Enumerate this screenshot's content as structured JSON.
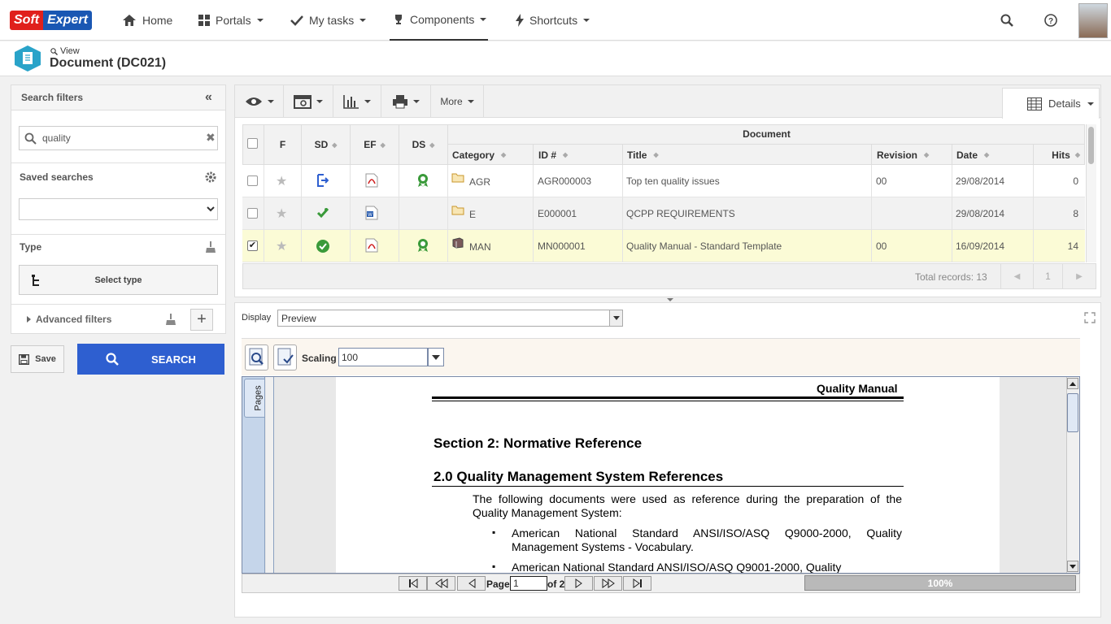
{
  "brand": {
    "part1": "Soft",
    "part2": "Expert"
  },
  "nav": {
    "home": "Home",
    "portals": "Portals",
    "mytasks": "My tasks",
    "components": "Components",
    "shortcuts": "Shortcuts"
  },
  "header": {
    "view": "View",
    "title": "Document (DC021)"
  },
  "filters": {
    "title": "Search filters",
    "search_value": "quality",
    "saved_searches": "Saved searches",
    "saved_value": "",
    "type": "Type",
    "select_type": "Select type",
    "advanced": "Advanced filters",
    "save": "Save",
    "search": "SEARCH"
  },
  "toolbar": {
    "more": "More",
    "details": "Details"
  },
  "grid": {
    "group_header": "Document",
    "columns": {
      "f": "F",
      "sd": "SD",
      "ef": "EF",
      "ds": "DS",
      "category": "Category",
      "id": "ID #",
      "title": "Title",
      "revision": "Revision",
      "date": "Date",
      "hits": "Hits"
    },
    "rows": [
      {
        "category": "AGR",
        "id": "AGR000003",
        "title": "Top ten quality issues",
        "revision": "00",
        "date": "29/08/2014",
        "hits": "0",
        "checked": false,
        "highlight": false
      },
      {
        "category": "E",
        "id": "E000001",
        "title": "QCPP REQUIREMENTS",
        "revision": "",
        "date": "29/08/2014",
        "hits": "8",
        "checked": false,
        "highlight": false
      },
      {
        "category": "MAN",
        "id": "MN000001",
        "title": "Quality Manual - Standard Template",
        "revision": "00",
        "date": "16/09/2014",
        "hits": "14",
        "checked": true,
        "highlight": true
      }
    ],
    "total": "Total records: 13",
    "page": "1"
  },
  "preview": {
    "display_label": "Display",
    "display_value": "Preview",
    "scaling_label": "Scaling",
    "scaling_value": "100",
    "pages_tab": "Pages",
    "doc": {
      "header": "Quality Manual",
      "section": "Section 2: Normative Reference",
      "subsection": "2.0 Quality Management System References",
      "para": "The following documents were used as reference during the preparation of the Quality Management System:",
      "bullet1": "American National Standard ANSI/ISO/ASQ Q9000-2000, Quality Management Systems - Vocabulary.",
      "bullet2": "American National Standard ANSI/ISO/ASQ Q9001-2000, Quality"
    },
    "page_label": "Page",
    "page_value": "1",
    "of_label": "of 2",
    "zoom": "100%"
  }
}
